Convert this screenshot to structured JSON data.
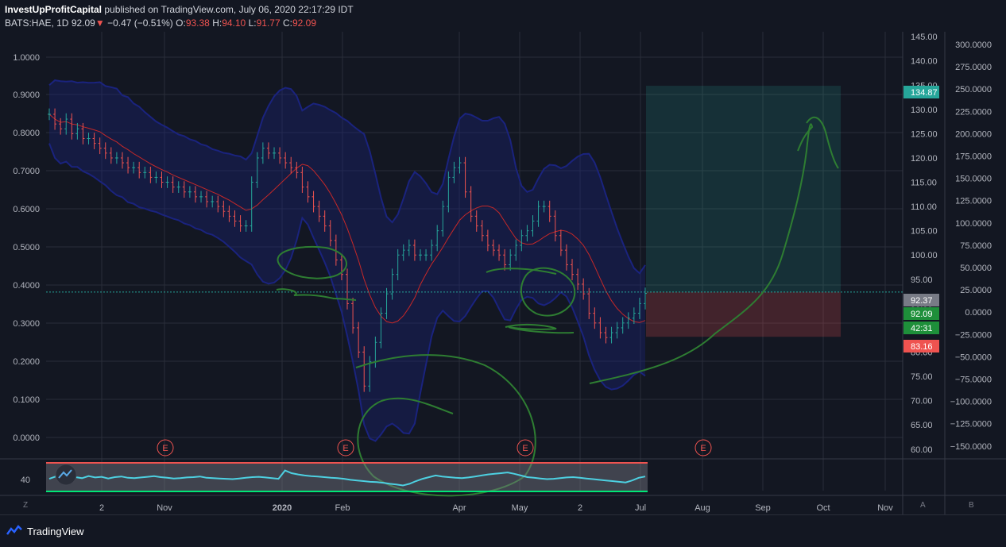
{
  "header": {
    "author": "InvestUpProfitCapital",
    "published": "published on TradingView.com, July 06, 2020 22:17:29 IDT",
    "symbol": "BATS:HAE, 1D",
    "last": "92.09",
    "arrow": "▼",
    "change": "−0.47 (−0.51%)",
    "o_label": "O:",
    "o": "93.38",
    "h_label": "H:",
    "h": "94.10",
    "l_label": "L:",
    "l": "91.77",
    "c_label": "C:",
    "c": "92.09"
  },
  "colors": {
    "background": "#131722",
    "grid": "#2a2e39",
    "up_candle": "#26a69a",
    "down_candle": "#ef5350",
    "band": "#1a237e",
    "midline": "#c62828",
    "drawing": "#2e7d32",
    "target_zone": "#26a69a",
    "stop_zone": "#ef5350",
    "rsi": "#4dd0e1"
  },
  "chart_data": [
    {
      "type": "line",
      "title": "BATS:HAE, 1D",
      "x_ticks": [
        "2",
        "Nov",
        "2020",
        "Feb",
        "Apr",
        "May",
        "2",
        "Jul",
        "Aug",
        "Sep",
        "Oct",
        "Nov"
      ],
      "price_ticks": [
        "145.00",
        "140.00",
        "135.00",
        "130.00",
        "125.00",
        "120.00",
        "115.00",
        "110.00",
        "105.00",
        "100.00",
        "95.00",
        "90.00",
        "85.00",
        "80.00",
        "75.00",
        "70.00",
        "65.00",
        "60.00"
      ],
      "left_ticks": [
        "1.0000",
        "0.9000",
        "0.8000",
        "0.7000",
        "0.6000",
        "0.5000",
        "0.4000",
        "0.3000",
        "0.2000",
        "0.1000",
        "0.0000"
      ],
      "right_ticks": [
        "300.0000",
        "275.0000",
        "250.0000",
        "225.0000",
        "200.0000",
        "175.0000",
        "150.0000",
        "125.0000",
        "100.0000",
        "75.0000",
        "50.0000",
        "25.0000",
        "0.0000",
        "−25.0000",
        "−50.0000",
        "−75.0000",
        "−100.0000",
        "−125.0000",
        "−150.0000"
      ],
      "ylim": [
        58,
        146
      ],
      "approx_closes": [
        129,
        127,
        126,
        128,
        125,
        126,
        124,
        124,
        123,
        122,
        121,
        120,
        120,
        119,
        118,
        118,
        117,
        117,
        116,
        116,
        115,
        115,
        114,
        114,
        113,
        113,
        112,
        112,
        111,
        111,
        110,
        109,
        108,
        107,
        106,
        106,
        115,
        120,
        122,
        121,
        121,
        120,
        119,
        118,
        117,
        114,
        112,
        110,
        108,
        106,
        103,
        99,
        96,
        90,
        85,
        80,
        73,
        78,
        82,
        88,
        92,
        96,
        100,
        101,
        102,
        100,
        100,
        100,
        102,
        105,
        110,
        116,
        118,
        119,
        113,
        108,
        106,
        104,
        102,
        101,
        100,
        98,
        100,
        102,
        104,
        105,
        107,
        110,
        110,
        108,
        104,
        101,
        98,
        96,
        94,
        92,
        88,
        86,
        84,
        83,
        84,
        85,
        86,
        87,
        88,
        90,
        92.09
      ],
      "earnings_markers": [
        "E",
        "E",
        "E",
        "E"
      ],
      "price_labels": [
        {
          "text": "134.87",
          "kind": "target"
        },
        {
          "text": "92.37",
          "kind": "entry"
        },
        {
          "text": "92.09",
          "kind": "last"
        },
        {
          "text": "42:31",
          "kind": "countdown"
        },
        {
          "text": "83.16",
          "kind": "stop"
        }
      ],
      "target": 134.87,
      "entry": 92.37,
      "stop": 83.16
    },
    {
      "type": "line",
      "title": "",
      "rsi_label": "40",
      "ylim": [
        0,
        100
      ],
      "approx_values": [
        45,
        52,
        48,
        55,
        50,
        47,
        53,
        49,
        51,
        46,
        50,
        52,
        48,
        47,
        49,
        51,
        53,
        50,
        48,
        46,
        47,
        49,
        50,
        52,
        48,
        47,
        46,
        45,
        44,
        46,
        48,
        50,
        51,
        49,
        47,
        45,
        70,
        62,
        58,
        55,
        53,
        52,
        50,
        48,
        47,
        45,
        42,
        40,
        38,
        36,
        35,
        33,
        30,
        28,
        25,
        30,
        38,
        45,
        50,
        55,
        52,
        50,
        48,
        47,
        49,
        52,
        55,
        58,
        60,
        62,
        64,
        60,
        55,
        50,
        48,
        46,
        44,
        45,
        47,
        49,
        50,
        48,
        46,
        44,
        42,
        40,
        38,
        36,
        34,
        40,
        48,
        52
      ]
    }
  ],
  "edge_buttons": {
    "left": "Z",
    "mid": "A",
    "right": "B"
  },
  "footer": {
    "brand": "TradingView"
  }
}
